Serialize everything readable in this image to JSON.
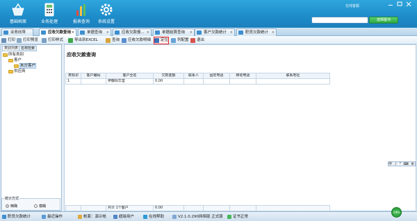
{
  "banner": {
    "nav": [
      {
        "label": "基础档案",
        "icon": "basket-icon"
      },
      {
        "label": "业务处理",
        "icon": "calculator-icon"
      },
      {
        "label": "报表查询",
        "icon": "bar-chart-icon"
      },
      {
        "label": "系统设置",
        "icon": "gear-icon"
      }
    ],
    "top_right_text": "在线客服",
    "search_placeholder": "",
    "search_button": "选择图书"
  },
  "tabs": [
    {
      "label": "业务向导",
      "active": false
    },
    {
      "label": "应收欠款查询",
      "active": true
    },
    {
      "label": "单据查询",
      "active": false
    },
    {
      "label": "应收欠款报...",
      "active": false
    },
    {
      "label": "单据结算查询",
      "active": false
    },
    {
      "label": "客户欠款统计",
      "active": false
    },
    {
      "label": "职员欠款统计",
      "active": false
    }
  ],
  "toolbar": [
    {
      "label": "打印",
      "icon": "printer-icon"
    },
    {
      "label": "打印预览",
      "icon": "print-preview-icon"
    },
    {
      "label": "打印样式",
      "icon": "print-style-icon"
    },
    {
      "label": "导出到EXCEL",
      "icon": "excel-icon"
    },
    {
      "label": "查询",
      "icon": "search-icon"
    },
    {
      "label": "应收欠款明细",
      "icon": "detail-icon"
    },
    {
      "label": "定位",
      "icon": "locate-icon"
    },
    {
      "label": "列配置",
      "icon": "columns-icon"
    },
    {
      "label": "退出",
      "icon": "exit-icon"
    }
  ],
  "left": {
    "tabs": [
      "类别列表",
      "名称检索"
    ],
    "tree": [
      {
        "label": "所有类别",
        "level": 0
      },
      {
        "label": "客户",
        "level": 1
      },
      {
        "label": "未分客户",
        "level": 2
      },
      {
        "label": "供应商",
        "level": 1
      }
    ],
    "stat_legend": "统计方式",
    "radios": [
      {
        "label": "精确",
        "checked": true
      },
      {
        "label": "模糊",
        "checked": false
      }
    ]
  },
  "main": {
    "title": "应收欠款查询",
    "columns": [
      "类标识",
      "客户编码",
      "客户全名",
      "欠款金额",
      "联系人",
      "固定电话",
      "移动电话",
      "联系地址"
    ],
    "rows": [
      [
        "1",
        "",
        "伊藤阳华堂",
        "0.00",
        "",
        "",
        "",
        ""
      ]
    ],
    "footer": [
      "",
      "",
      "共计 1个客户",
      "0.00",
      "",
      "",
      "",
      ""
    ],
    "ime_bar": "中 ♪ ° ⌨ ⚙"
  },
  "status": [
    {
      "label": "职员欠款统计",
      "icon": "tab-icon"
    },
    {
      "label": "最近操作",
      "icon": "history-icon"
    },
    {
      "label": "帐套：演示帐",
      "icon": "account-icon"
    },
    {
      "label": "超级用户",
      "icon": "user-icon"
    },
    {
      "label": "在线帮助",
      "icon": "help-icon"
    },
    {
      "label": "V2.1.0.290网络版 正式版",
      "icon": "version-icon"
    },
    {
      "label": "证书正常",
      "icon": "certificate-icon"
    }
  ],
  "gauge_label": "24%"
}
